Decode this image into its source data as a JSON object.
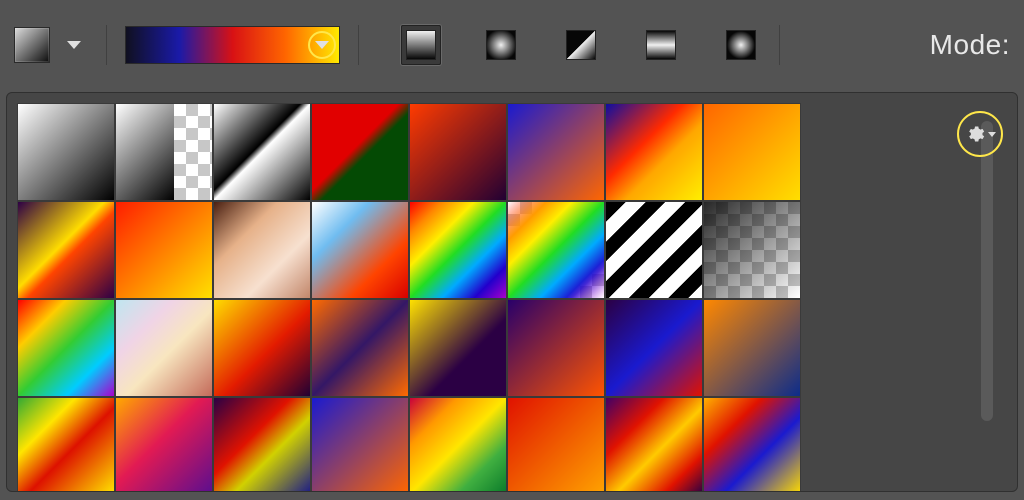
{
  "toolbar": {
    "mode_label": "Mode:",
    "gradient_types": [
      {
        "name": "linear",
        "selected": true
      },
      {
        "name": "radial",
        "selected": false
      },
      {
        "name": "angle",
        "selected": false
      },
      {
        "name": "reflected",
        "selected": false
      },
      {
        "name": "diamond",
        "selected": false
      }
    ],
    "active_gradient_stops": [
      "#101020",
      "#1a1aa8",
      "#d81114",
      "#ff6600",
      "#ffea00"
    ]
  },
  "panel": {
    "settings_icon": "gear-icon",
    "presets": [
      {
        "name": "Foreground to Background"
      },
      {
        "name": "Foreground to Transparent"
      },
      {
        "name": "Black, White"
      },
      {
        "name": "Red, Green"
      },
      {
        "name": "Violet, Orange"
      },
      {
        "name": "Blue, Orange"
      },
      {
        "name": "Blue, Red, Yellow"
      },
      {
        "name": "Orange, Yellow"
      },
      {
        "name": "Violet, Yellow, Orange"
      },
      {
        "name": "Red, Yellow"
      },
      {
        "name": "Copper"
      },
      {
        "name": "Chrome"
      },
      {
        "name": "Spectrum"
      },
      {
        "name": "Transparent Rainbow"
      },
      {
        "name": "Transparent Stripes"
      },
      {
        "name": "Neutral Density"
      },
      {
        "name": "Rainbow"
      },
      {
        "name": "Pastels"
      },
      {
        "name": "Yellow, Red, Violet"
      },
      {
        "name": "Orange, Violet, Orange"
      },
      {
        "name": "Yellow, Violet"
      },
      {
        "name": "Violet, Orange 2"
      },
      {
        "name": "Violet, Blue, Red"
      },
      {
        "name": "Orange, Blue"
      },
      {
        "name": "Green, Yellow, Red"
      },
      {
        "name": "Orange, Pink, Violet"
      },
      {
        "name": "Violet, Red, Yellow, Blue"
      },
      {
        "name": "Blue, Orange 2"
      },
      {
        "name": "Red, Orange, Yellow, Green"
      },
      {
        "name": "Red, Orange"
      },
      {
        "name": "Violet, Red, Yellow"
      },
      {
        "name": "Yellow, Red, Blue"
      }
    ]
  },
  "colors": {
    "highlight": "#ffe74a"
  }
}
